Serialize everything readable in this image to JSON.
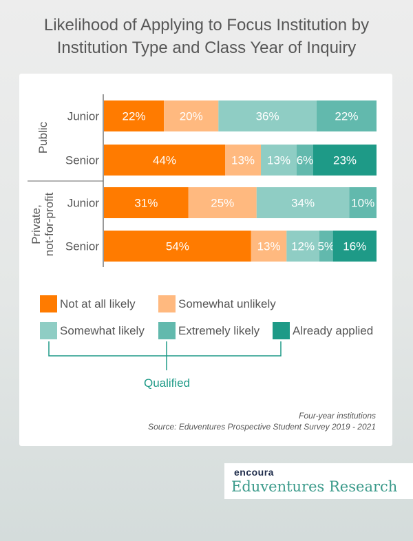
{
  "chart_data": {
    "type": "bar",
    "orientation": "horizontal-stacked-100",
    "title": "Likelihood of Applying to Focus Institution by Institution Type and Class Year of Inquiry",
    "groups": [
      {
        "label": "Public",
        "rows": [
          "Junior",
          "Senior"
        ]
      },
      {
        "label": "Private, not-for-profit",
        "rows": [
          "Junior",
          "Senior"
        ]
      }
    ],
    "categories": [
      "Public - Junior",
      "Public - Senior",
      "Private, not-for-profit - Junior",
      "Private, not-for-profit - Senior"
    ],
    "row_labels": [
      "Junior",
      "Senior",
      "Junior",
      "Senior"
    ],
    "series": [
      {
        "name": "Not at all likely",
        "color": "#ff7b00",
        "values": [
          22,
          44,
          31,
          54
        ]
      },
      {
        "name": "Somewhat unlikely",
        "color": "#ffb97f",
        "values": [
          20,
          13,
          25,
          13
        ]
      },
      {
        "name": "Somewhat likely",
        "color": "#8fcdc4",
        "values": [
          36,
          13,
          34,
          12
        ]
      },
      {
        "name": "Extremely likely",
        "color": "#62b9ad",
        "values": [
          22,
          6,
          10,
          5
        ]
      },
      {
        "name": "Already applied",
        "color": "#1e9a87",
        "values": [
          0,
          23,
          0,
          16
        ]
      }
    ],
    "xlim": [
      0,
      100
    ],
    "legend_placement": "bottom",
    "legend_bracket_label": "Qualified",
    "legend_bracket_series": [
      "Somewhat likely",
      "Extremely likely",
      "Already applied"
    ],
    "notes": [
      "Four-year institutions",
      "Source: Eduventures Prospective Student Survey 2019 - 2021"
    ]
  },
  "title_lines": [
    "Likelihood of Applying to Focus Institution by",
    "Institution Type and Class Year of Inquiry"
  ],
  "group_label_public": "Public",
  "group_label_private_1": "Private,",
  "group_label_private_2": "not-for-profit",
  "note_line1": "Four-year institutions",
  "note_line2": "Source: Eduventures Prospective Student Survey 2019 - 2021",
  "logo": {
    "brand": "encoura",
    "sub": "Eduventures Research"
  }
}
